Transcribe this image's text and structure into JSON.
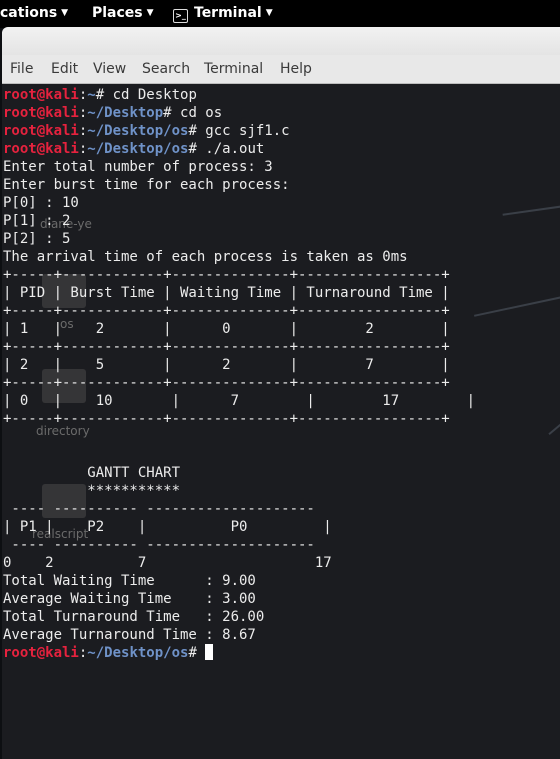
{
  "topbar": {
    "applications": "cations",
    "places": "Places",
    "terminal": "Terminal"
  },
  "menu": [
    "File",
    "Edit",
    "View",
    "Search",
    "Terminal",
    "Help"
  ],
  "prompt": {
    "user": "root@kali",
    "separator": ":"
  },
  "desktop_icons": [
    "diane-ye",
    "os",
    "directory",
    "realscript"
  ],
  "terminal_lines": [
    {
      "type": "prompt",
      "path": "~",
      "cmd": "# cd Desktop"
    },
    {
      "type": "prompt",
      "path": "~/Desktop",
      "cmd": "# cd os"
    },
    {
      "type": "prompt",
      "path": "~/Desktop/os",
      "cmd": "# gcc sjf1.c"
    },
    {
      "type": "prompt",
      "path": "~/Desktop/os",
      "cmd": "# ./a.out"
    },
    {
      "type": "text",
      "text": "Enter total number of process: 3"
    },
    {
      "type": "text",
      "text": "Enter burst time for each process:"
    },
    {
      "type": "text",
      "text": "P[0] : 10"
    },
    {
      "type": "text",
      "text": "P[1] : 2"
    },
    {
      "type": "text",
      "text": "P[2] : 5"
    },
    {
      "type": "text",
      "text": "The arrival time of each process is taken as 0ms"
    },
    {
      "type": "text",
      "text": "+-----+------------+--------------+-----------------+"
    },
    {
      "type": "text",
      "text": "| PID | Burst Time | Waiting Time | Turnaround Time |"
    },
    {
      "type": "text",
      "text": "+-----+------------+--------------+-----------------+"
    },
    {
      "type": "text",
      "text": "| 1   |    2       |      0       |        2        |"
    },
    {
      "type": "text",
      "text": "+-----+------------+--------------+-----------------+"
    },
    {
      "type": "text",
      "text": "| 2   |    5       |      2       |        7        |"
    },
    {
      "type": "text",
      "text": "+-----+------------+--------------+-----------------+"
    },
    {
      "type": "text",
      "text": "| 0   |    10       |      7        |        17        |"
    },
    {
      "type": "text",
      "text": "+-----+------------+--------------+-----------------+"
    },
    {
      "type": "text",
      "text": ""
    },
    {
      "type": "text",
      "text": ""
    },
    {
      "type": "text",
      "text": "          GANTT CHART"
    },
    {
      "type": "text",
      "text": "          ***********"
    },
    {
      "type": "text",
      "text": " ---- ---------- --------------------"
    },
    {
      "type": "text",
      "text": "| P1 |    P2    |          P0         |"
    },
    {
      "type": "text",
      "text": " ---- ---------- --------------------"
    },
    {
      "type": "text",
      "text": "0    2          7                    17"
    },
    {
      "type": "text",
      "text": "Total Waiting Time      : 9.00"
    },
    {
      "type": "text",
      "text": "Average Waiting Time    : 3.00"
    },
    {
      "type": "text",
      "text": "Total Turnaround Time   : 26.00"
    },
    {
      "type": "text",
      "text": "Average Turnaround Time : 8.67"
    },
    {
      "type": "prompt",
      "path": "~/Desktop/os",
      "cmd": "# ",
      "cursor": true
    }
  ]
}
